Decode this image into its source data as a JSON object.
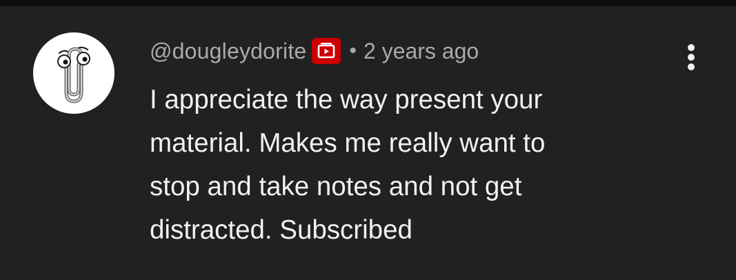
{
  "comment": {
    "avatar_icon": "paperclip-mascot-icon",
    "author": "@dougleydorite",
    "badge_icon": "youtube-member-badge-icon",
    "separator": "•",
    "timestamp": "2 years ago",
    "text_lines": [
      "I appreciate the way present your",
      "material. Makes me really want to",
      "stop and take notes and not get",
      "distracted. Subscribed"
    ],
    "more_icon": "more-vertical-icon"
  },
  "colors": {
    "background": "#212121",
    "top_bar": "#0f0f0f",
    "meta_text": "#aaaaaa",
    "body_text": "#f1f1f1",
    "badge": "#cc0000"
  }
}
